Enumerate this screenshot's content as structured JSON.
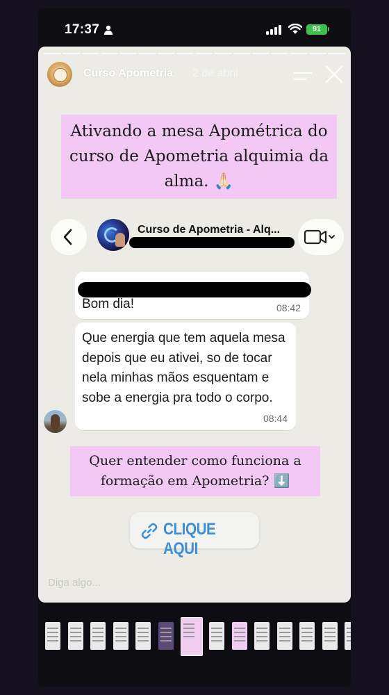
{
  "status_bar": {
    "time": "17:37",
    "battery": "91"
  },
  "story": {
    "account_name": "Curso Apometria",
    "date": "2 de abril",
    "caption_top": "Ativando a mesa Apométrica do curso de Apometria alquimia da alma. 🙏🏻",
    "caption_bottom": "Quer entender como funciona a formação em Apometria? ⬇️",
    "cta_label": "CLIQUE AQUI",
    "reply_placeholder": "Diga algo...",
    "progress_segments": 16
  },
  "chat": {
    "group_title": "Curso de Apometria - Alq...",
    "messages": [
      {
        "text": "Bom dia!",
        "time": "08:42"
      },
      {
        "text": "Que energia que tem aquela mesa depois que eu ativei, so de tocar nela minhas mãos esquentam e sobe a energia pra todo o corpo.",
        "time": "08:44"
      }
    ]
  },
  "thumbnails": [
    "light",
    "light",
    "light",
    "light",
    "light",
    "dark",
    "pink-active",
    "light",
    "pink",
    "light",
    "light",
    "light",
    "light",
    "light",
    "dark"
  ],
  "colors": {
    "caption_bg": "#f4c8f5",
    "cta_text": "#3c8fd6",
    "battery": "#3cc24a",
    "story_bg": "#ecebe6"
  },
  "icons": [
    "person-icon",
    "signal-icon",
    "wifi-icon",
    "menu-icon",
    "close-icon",
    "back-chevron-icon",
    "video-camera-icon",
    "chevron-down-icon",
    "link-icon"
  ]
}
